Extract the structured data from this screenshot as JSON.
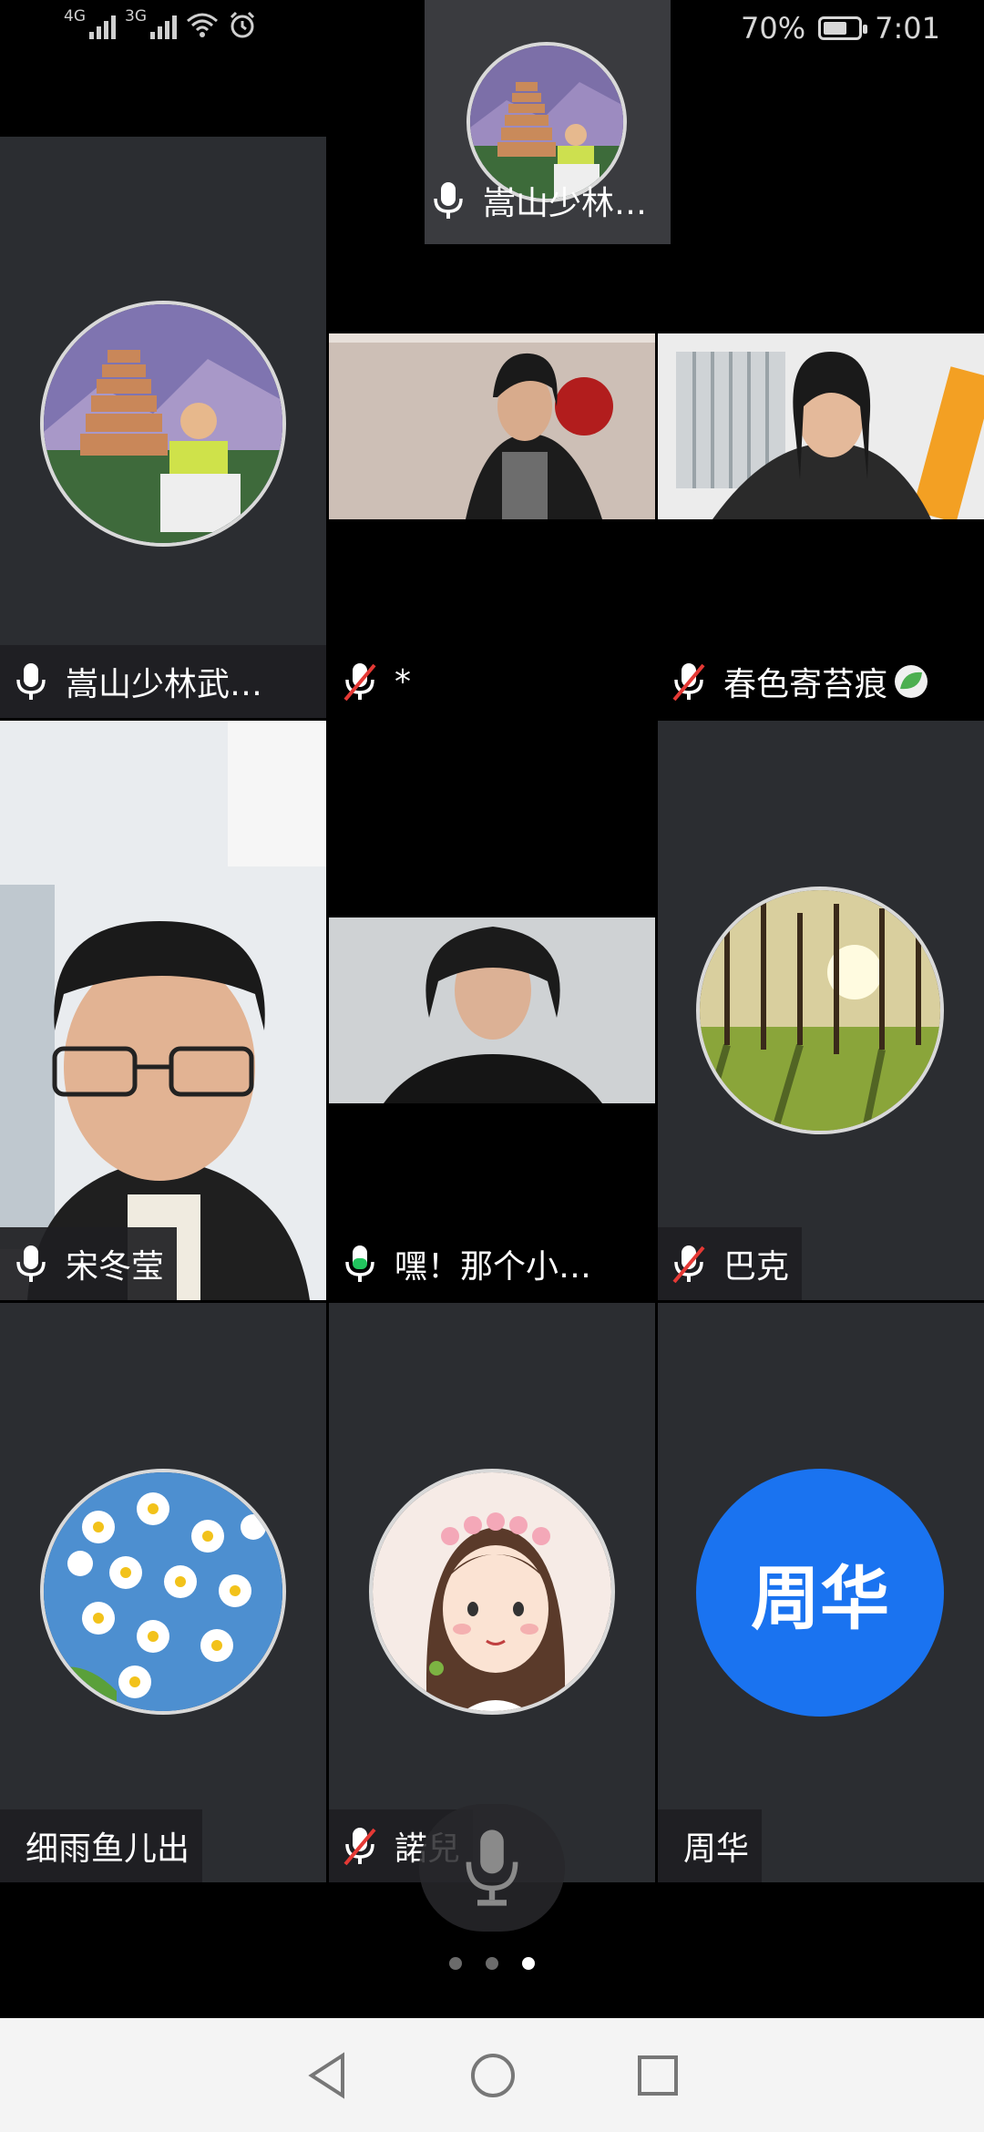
{
  "status_bar": {
    "sim1": "4G",
    "sim2": "3G",
    "battery": "70%",
    "battery_level": 0.7,
    "time": "7:01"
  },
  "participants": {
    "top_small": {
      "name": "嵩山少林…",
      "mic": "on"
    },
    "p1": {
      "name": "嵩山少林武…",
      "mic": "on"
    },
    "p2": {
      "name": "*",
      "mic": "muted"
    },
    "p3": {
      "name": "春色寄苔痕",
      "mic": "muted"
    },
    "p4": {
      "name": "宋冬莹",
      "mic": "on"
    },
    "p5": {
      "name": "嘿！那个小…",
      "mic": "speaking"
    },
    "p6": {
      "name": "巴克",
      "mic": "muted"
    },
    "p7": {
      "name": "细雨鱼儿出",
      "mic": "none"
    },
    "p8": {
      "name": "諾兒",
      "mic": "muted"
    },
    "p9": {
      "name": "周华",
      "avatar_text": "周华",
      "mic": "none"
    }
  },
  "pager": {
    "pages": 3,
    "current": 3
  },
  "colors": {
    "accent_blue": "#1a73f0",
    "speaking_green": "#22c55e",
    "muted_red": "#e53935"
  }
}
